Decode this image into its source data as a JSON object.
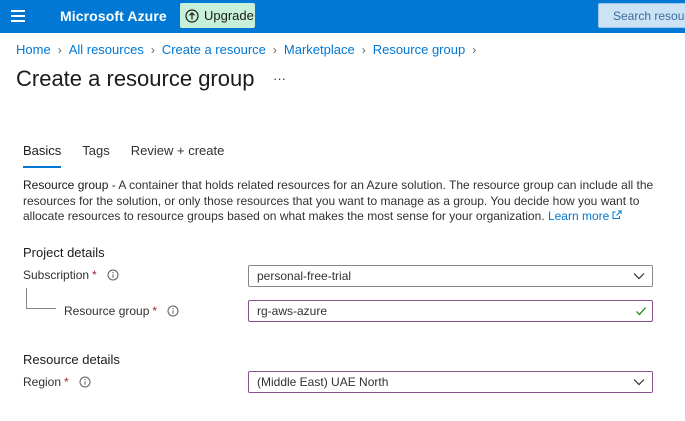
{
  "topbar": {
    "brand": "Microsoft Azure",
    "upgrade_label": "Upgrade",
    "search_placeholder": "Search resources"
  },
  "breadcrumb": [
    "Home",
    "All resources",
    "Create a resource",
    "Marketplace",
    "Resource group"
  ],
  "page": {
    "title": "Create a resource group",
    "more": "···"
  },
  "tabs": [
    {
      "label": "Basics",
      "active": true
    },
    {
      "label": "Tags",
      "active": false
    },
    {
      "label": "Review + create",
      "active": false
    }
  ],
  "description": {
    "term": "Resource group",
    "text": " - A container that holds related resources for an Azure solution. The resource group can include all the resources for the solution, or only those resources that you want to manage as a group. You decide how you want to allocate resources to resource groups based on what makes the most sense for your organization. ",
    "link": "Learn more"
  },
  "project_details": {
    "title": "Project details",
    "subscription": {
      "label": "Subscription",
      "required": "*",
      "value": "personal-free-trial"
    },
    "resource_group": {
      "label": "Resource group",
      "required": "*",
      "value": "rg-aws-azure"
    }
  },
  "resource_details": {
    "title": "Resource details",
    "region": {
      "label": "Region",
      "required": "*",
      "value": "(Middle East) UAE North"
    }
  },
  "colors": {
    "accent": "#0078d4",
    "upgrade_bg": "#c7f0d8",
    "focus_border": "#8a4f8f",
    "valid_check": "#107c10",
    "required": "#a4262c"
  },
  "icons": [
    "hamburger-icon",
    "upgrade-icon",
    "search-icon",
    "more-icon",
    "external-link-icon",
    "info-icon",
    "chevron-down-icon",
    "check-icon"
  ]
}
